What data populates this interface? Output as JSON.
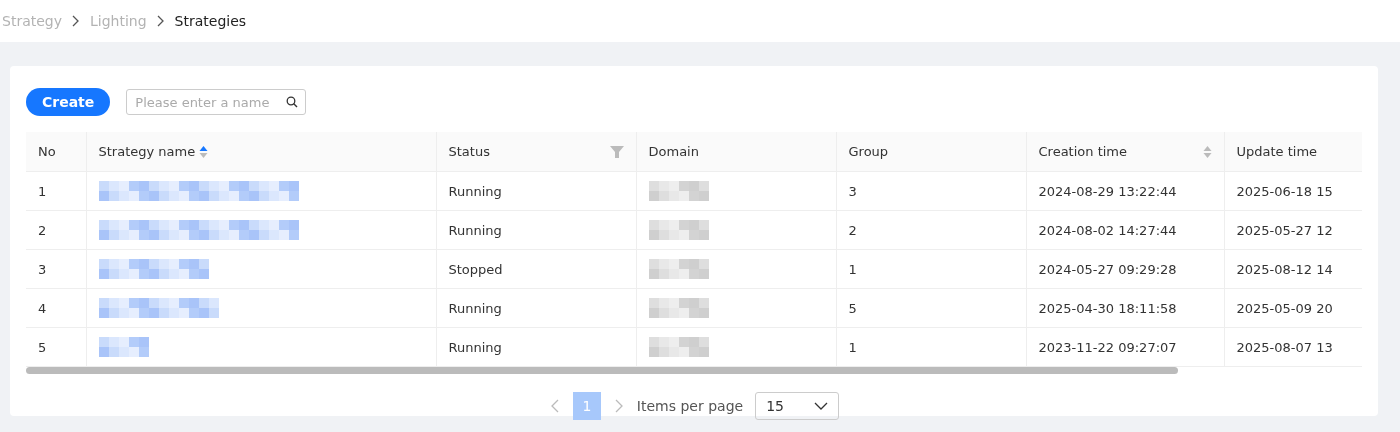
{
  "breadcrumb": [
    {
      "label": "Strategy",
      "current": false
    },
    {
      "label": "Lighting",
      "current": false
    },
    {
      "label": "Strategies",
      "current": true
    }
  ],
  "toolbar": {
    "create": "Create",
    "search": {
      "placeholder": "Please enter a name"
    }
  },
  "table": {
    "columns": [
      {
        "label": "No",
        "kind": "plain"
      },
      {
        "label": "Strategy name",
        "kind": "sort",
        "sorted": true
      },
      {
        "label": "Status",
        "kind": "filter"
      },
      {
        "label": "Domain",
        "kind": "plain"
      },
      {
        "label": "Group",
        "kind": "plain"
      },
      {
        "label": "Creation time",
        "kind": "sort",
        "sorted": false
      },
      {
        "label": "Update time",
        "kind": "plain"
      }
    ],
    "rows": [
      {
        "no": "1",
        "status": "Running",
        "group": "3",
        "created": "2024-08-29 13:22:44",
        "updated": "2025-06-18 15"
      },
      {
        "no": "2",
        "status": "Running",
        "group": "2",
        "created": "2024-08-02 14:27:44",
        "updated": "2025-05-27 12"
      },
      {
        "no": "3",
        "status": "Stopped",
        "group": "1",
        "created": "2024-05-27 09:29:28",
        "updated": "2025-08-12 14"
      },
      {
        "no": "4",
        "status": "Running",
        "group": "5",
        "created": "2025-04-30 18:11:58",
        "updated": "2025-05-09 20"
      },
      {
        "no": "5",
        "status": "Running",
        "group": "1",
        "created": "2023-11-22 09:27:07",
        "updated": "2025-08-07 13"
      }
    ]
  },
  "pagination": {
    "prev_disabled": true,
    "next_disabled": true,
    "pages": [
      {
        "label": "1",
        "selected": true
      }
    ],
    "page_size_label": "Items per page",
    "page_size": "15"
  }
}
